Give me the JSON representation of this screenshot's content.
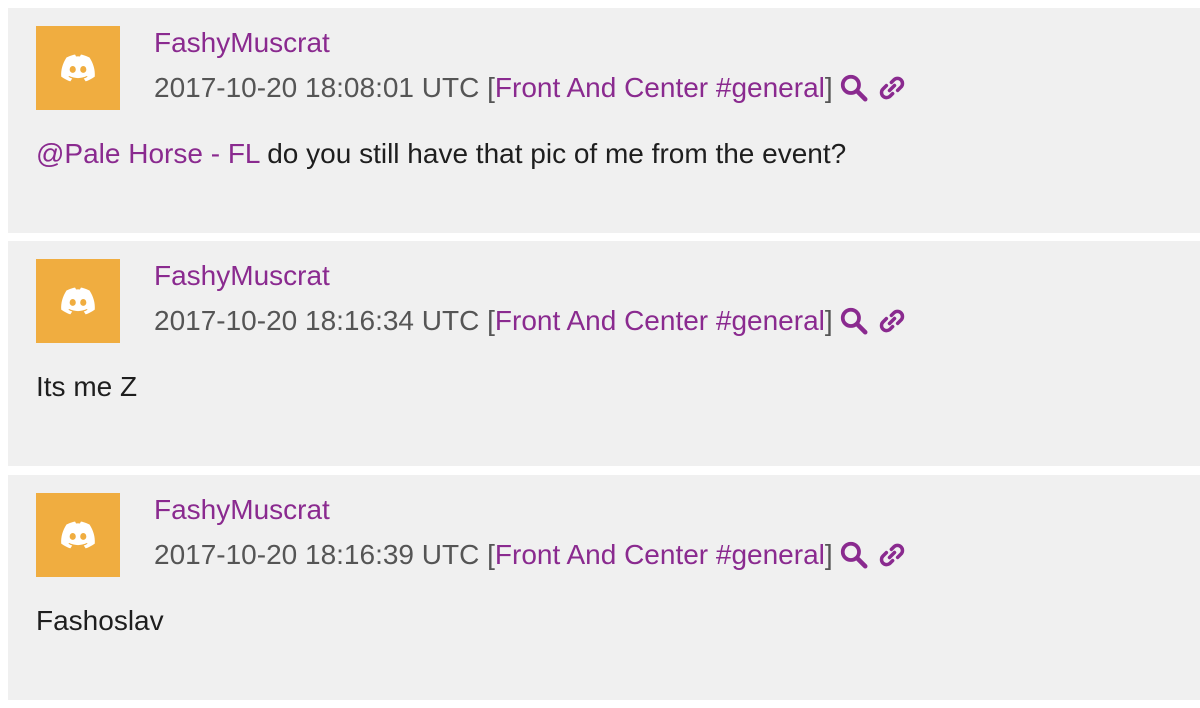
{
  "colors": {
    "accent": "#8a2a8f",
    "avatar_bg": "#f0ad40",
    "card_bg": "#f0f0f0",
    "meta_text": "#555555",
    "body_text": "#1e1e1e"
  },
  "icons": {
    "avatar": "discord-logo-icon",
    "search": "search-icon",
    "permalink": "link-icon"
  },
  "messages": [
    {
      "username": "FashyMuscrat",
      "timestamp": "2017-10-20 18:08:01 UTC",
      "open_bracket": "[",
      "channel": "Front And Center #general",
      "close_bracket": "]",
      "mention": "@Pale Horse - FL",
      "text": " do you still have that pic of me from the event?"
    },
    {
      "username": "FashyMuscrat",
      "timestamp": "2017-10-20 18:16:34 UTC",
      "open_bracket": "[",
      "channel": "Front And Center #general",
      "close_bracket": "]",
      "mention": "",
      "text": "Its me Z"
    },
    {
      "username": "FashyMuscrat",
      "timestamp": "2017-10-20 18:16:39 UTC",
      "open_bracket": "[",
      "channel": "Front And Center #general",
      "close_bracket": "]",
      "mention": "",
      "text": "Fashoslav"
    }
  ]
}
